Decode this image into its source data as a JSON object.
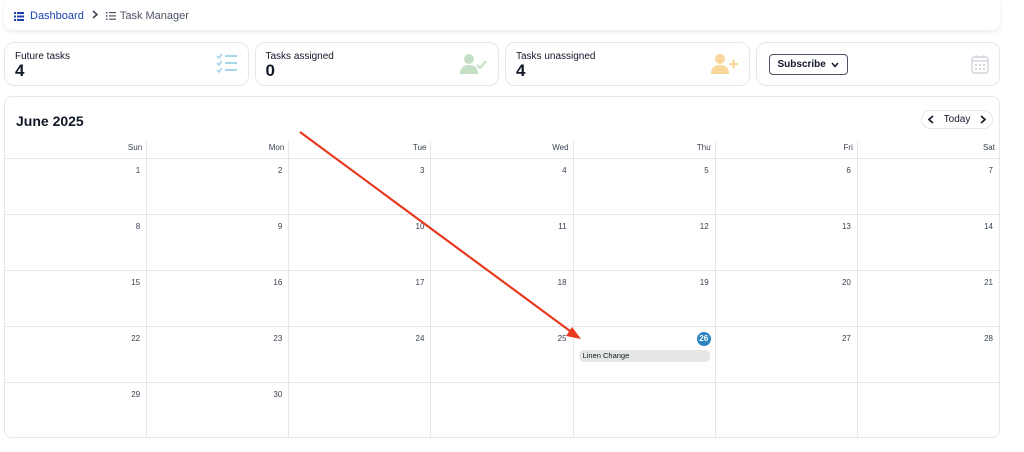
{
  "breadcrumb": {
    "home": "Dashboard",
    "current": "Task Manager"
  },
  "stats": [
    {
      "label": "Future tasks",
      "value": "4",
      "icon": "checklist-icon"
    },
    {
      "label": "Tasks assigned",
      "value": "0",
      "icon": "user-check-icon"
    },
    {
      "label": "Tasks unassigned",
      "value": "4",
      "icon": "user-plus-icon"
    }
  ],
  "subscribe": {
    "label": "Subscribe",
    "icon": "calendar-icon"
  },
  "calendar": {
    "title": "June 2025",
    "today_label": "Today",
    "days_of_week": [
      "Sun",
      "Mon",
      "Tue",
      "Wed",
      "Thu",
      "Fri",
      "Sat"
    ],
    "weeks": [
      [
        "1",
        "2",
        "3",
        "4",
        "5",
        "6",
        "7"
      ],
      [
        "8",
        "9",
        "10",
        "11",
        "12",
        "13",
        "14"
      ],
      [
        "15",
        "16",
        "17",
        "18",
        "19",
        "20",
        "21"
      ],
      [
        "22",
        "23",
        "24",
        "25",
        "26",
        "27",
        "28"
      ],
      [
        "29",
        "30",
        "",
        "",
        "",
        "",
        ""
      ]
    ],
    "today": "26",
    "events": [
      {
        "day": "26",
        "title": "Linen Change"
      }
    ]
  },
  "colors": {
    "accent": "#1e40af",
    "today": "#2e86c1",
    "annotation_arrow": "#e8391f"
  }
}
